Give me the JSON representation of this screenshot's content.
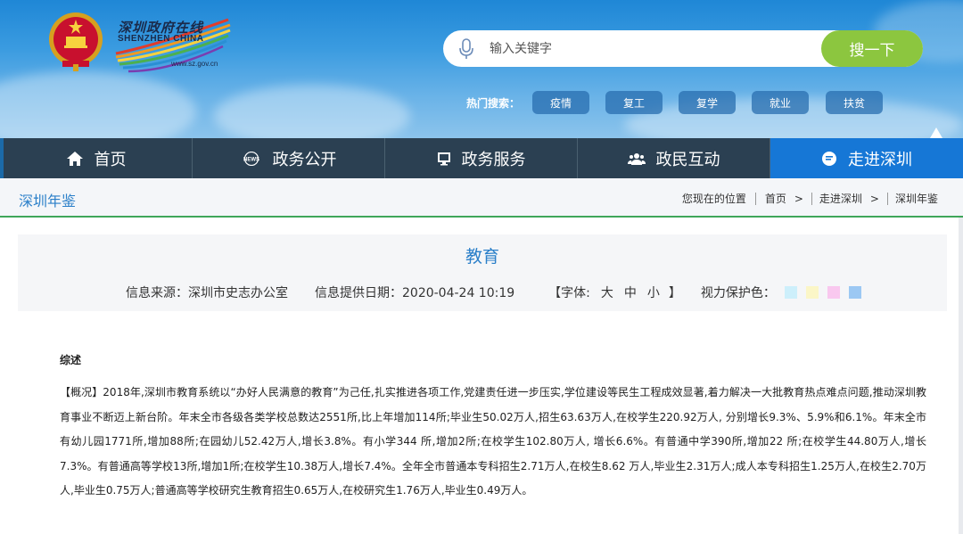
{
  "header": {
    "logo_cn": "深圳政府在线",
    "logo_en": "SHENZHEN CHINA",
    "logo_url": "www.sz.gov.cn"
  },
  "search": {
    "placeholder": "输入关键字",
    "button_label": "搜一下",
    "hot_label": "热门搜索：",
    "hot_tags": [
      "疫情",
      "复工",
      "复学",
      "就业",
      "扶贫"
    ]
  },
  "nav": {
    "items": [
      {
        "label": "首页",
        "icon": "home-icon"
      },
      {
        "label": "政务公开",
        "icon": "news-icon"
      },
      {
        "label": "政务服务",
        "icon": "monitor-icon"
      },
      {
        "label": "政民互动",
        "icon": "people-icon"
      },
      {
        "label": "走进深圳",
        "icon": "chat-icon"
      }
    ],
    "active_index": 4
  },
  "breadcrumb": {
    "section_title": "深圳年鉴",
    "location_label": "您现在的位置",
    "items": [
      "首页",
      "走进深圳",
      "深圳年鉴"
    ]
  },
  "article": {
    "title": "教育",
    "source": "信息来源：深圳市史志办公室",
    "date": "信息提供日期：2020-04-24 10:19",
    "font_label": "【字体:",
    "font_sizes": [
      "大",
      "中",
      "小"
    ],
    "font_end": "】",
    "eye_care_label": "视力保护色：",
    "eye_care_colors": [
      "#cdeffb",
      "#fbf6c7",
      "#f9c8ef",
      "#9cc8f3"
    ],
    "summary_title": "综述",
    "paragraph": "【概况】2018年,深圳市教育系统以“办好人民满意的教育”为己任,扎实推进各项工作,党建责任进一步压实,学位建设等民生工程成效显著,着力解决一大批教育热点难点问题,推动深圳教育事业不断迈上新台阶。年末全市各级各类学校总数达2551所,比上年增加114所;毕业生50.02万人,招生63.63万人,在校学生220.92万人, 分别增长9.3%、5.9%和6.1%。年末全市有幼儿园1771所,增加88所;在园幼儿52.42万人,增长3.8%。有小学344 所,增加2所;在校学生102.80万人, 增长6.6%。有普通中学390所,增加22 所;在校学生44.80万人,增长7.3%。有普通高等学校13所,增加1所;在校学生10.38万人,增长7.4%。全年全市普通本专科招生2.71万人,在校生8.62 万人,毕业生2.31万人;成人本专科招生1.25万人,在校生2.70万人,毕业生0.75万人;普通高等学校研究生教育招生0.65万人,在校研究生1.76万人,毕业生0.49万人。"
  }
}
